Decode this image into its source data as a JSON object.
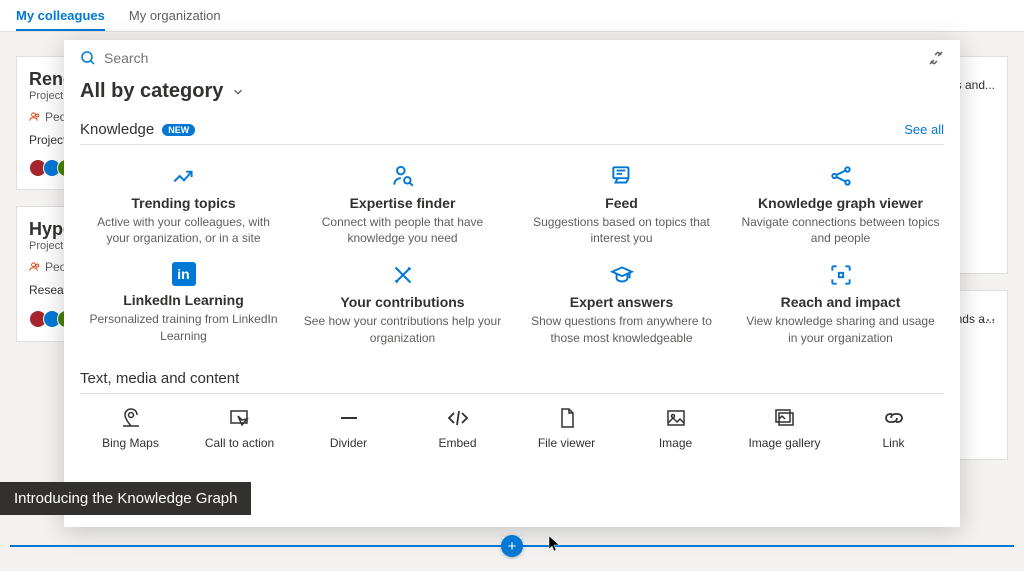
{
  "tabs": {
    "colleagues": "My colleagues",
    "organization": "My organization"
  },
  "bg": {
    "left": [
      {
        "title": "Renew",
        "sub": "Project",
        "meta": "People",
        "desc": "Project Renew is a bold new initiative to get to carbon neutral in all processes"
      },
      {
        "title": "Hyper",
        "sub": "Project",
        "meta": "People",
        "desc": "Research from Hyper suggests increased bands at"
      }
    ],
    "right": [
      {
        "desc": "pursuit at es and..."
      },
      {
        "desc": "rested istry. ends a..."
      }
    ]
  },
  "panel": {
    "search_placeholder": "Search",
    "category_label": "All by category",
    "sections": {
      "knowledge": {
        "title": "Knowledge",
        "badge": "NEW",
        "see_all": "See all",
        "tiles": [
          {
            "title": "Trending topics",
            "desc": "Active with your colleagues, with your organization, or in a site"
          },
          {
            "title": "Expertise finder",
            "desc": "Connect with people that have knowledge you need"
          },
          {
            "title": "Feed",
            "desc": "Suggestions based on topics that interest you"
          },
          {
            "title": "Knowledge graph viewer",
            "desc": "Navigate connections between topics and people"
          },
          {
            "title": "LinkedIn Learning",
            "desc": "Personalized training from LinkedIn Learning"
          },
          {
            "title": "Your contributions",
            "desc": "See how your contributions help your organization"
          },
          {
            "title": "Expert answers",
            "desc": "Show questions from anywhere to those most knowledgeable"
          },
          {
            "title": "Reach and impact",
            "desc": "View knowledge sharing and usage in your organization"
          }
        ]
      },
      "content": {
        "title": "Text, media and content",
        "items": [
          {
            "label": "Bing Maps"
          },
          {
            "label": "Call to action"
          },
          {
            "label": "Divider"
          },
          {
            "label": "Embed"
          },
          {
            "label": "File viewer"
          },
          {
            "label": "Image"
          },
          {
            "label": "Image gallery"
          },
          {
            "label": "Link"
          }
        ]
      }
    }
  },
  "caption": "Introducing the Knowledge Graph"
}
